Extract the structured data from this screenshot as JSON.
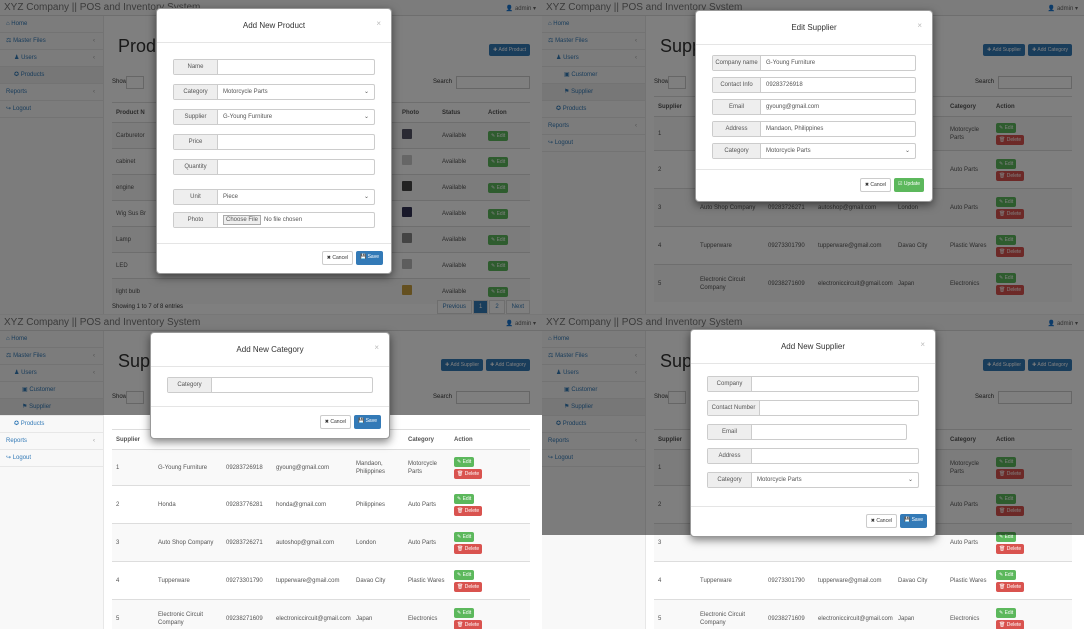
{
  "app_title": "XYZ Company || POS and Inventory System",
  "admin_label": "admin",
  "nav": {
    "home": "Home",
    "master_files": "Master Files",
    "users": "Users",
    "customer": "Customer",
    "supplier": "Supplier",
    "products": "Products",
    "reports": "Reports",
    "logout": "Logout"
  },
  "icons": {
    "home": "home-icon",
    "products": "products-icon",
    "supplier": "supplier-icon",
    "customer": "customer-icon",
    "users": "users-icon",
    "master": "master-files-icon",
    "logout": "logout-icon",
    "user": "user-icon",
    "cancel": "times-icon",
    "save": "floppy-icon",
    "edit": "pencil-icon",
    "delete": "trash-icon"
  },
  "colors": {
    "primary": "#337ab7",
    "success": "#5cb85c",
    "danger": "#d9534f"
  },
  "common": {
    "show": "Show",
    "search": "Search",
    "cancel": "Cancel",
    "save": "Save",
    "update": "Update",
    "edit": "Edit",
    "delete": "Delete",
    "add_supplier": "Add Supplier",
    "add_category": "Add Category",
    "add_product": "Add Product"
  },
  "q1": {
    "title": "Produ",
    "cols": [
      "Product N",
      "",
      "Photo",
      "Status",
      "Action"
    ],
    "rows": [
      {
        "name": "Carburetor",
        "status": "Available"
      },
      {
        "name": "cabinet",
        "status": "Available"
      },
      {
        "name": "engine",
        "status": "Available"
      },
      {
        "name": "Wig Sus Br",
        "status": "Available"
      },
      {
        "name": "Lamp",
        "status": "Available"
      },
      {
        "name": "LED",
        "status": "Available"
      },
      {
        "name": "light bulb",
        "status": "Available"
      }
    ],
    "footer": "Showing 1 to 7 of 8 entries",
    "pager": [
      "Previous",
      "1",
      "2",
      "Next"
    ],
    "modal": {
      "title": "Add New Product",
      "fields": [
        {
          "label": "Name",
          "value": ""
        },
        {
          "label": "Category",
          "value": "Motorcycle Parts"
        },
        {
          "label": "Supplier",
          "value": "G-Young Furniture"
        },
        {
          "label": "Price",
          "value": ""
        },
        {
          "label": "Quantity",
          "value": ""
        },
        {
          "label": "Unit",
          "value": "Piece"
        },
        {
          "label": "Photo",
          "value": "No file chosen"
        }
      ],
      "choose_file": "Choose File"
    }
  },
  "q2": {
    "title": "Supp",
    "cols": [
      "Supplier",
      "",
      "",
      "",
      "Category",
      "Action"
    ],
    "rows": [
      {
        "id": "1",
        "company": "",
        "contact": "",
        "email": "",
        "address": "",
        "category": "Motorcycle Parts"
      },
      {
        "id": "2",
        "company": "",
        "contact": "",
        "email": "",
        "address": "",
        "category": "Auto Parts"
      },
      {
        "id": "3",
        "company": "Auto Shop Company",
        "contact": "09283726271",
        "email": "autoshop@gmail.com",
        "address": "London",
        "category": "Auto Parts"
      },
      {
        "id": "4",
        "company": "Tupperware",
        "contact": "09273301790",
        "email": "tupperware@gmail.com",
        "address": "Davao City",
        "category": "Plastic Wares"
      },
      {
        "id": "5",
        "company": "Electronic Circuit Company",
        "contact": "09238271609",
        "email": "electroniccircuit@gmail.com",
        "address": "Japan",
        "category": "Electronics"
      }
    ],
    "modal": {
      "title": "Edit Supplier",
      "fields": [
        {
          "label": "Company name",
          "value": "G-Young Furniture"
        },
        {
          "label": "Contact Info",
          "value": "09283726918"
        },
        {
          "label": "Email",
          "value": "gyoung@gmail.com"
        },
        {
          "label": "Address",
          "value": "Mandaon, Philippines"
        },
        {
          "label": "Category",
          "value": "Motorcycle Parts"
        }
      ]
    }
  },
  "q3": {
    "title": "Supp",
    "cols": [
      "Supplier",
      "",
      "",
      "",
      "Category",
      "Action"
    ],
    "rows": [
      {
        "id": "1",
        "company": "G-Young Furniture",
        "contact": "09283726918",
        "email": "gyoung@gmail.com",
        "address": "Mandaon, Philippines",
        "category": "Motorcycle Parts"
      },
      {
        "id": "2",
        "company": "Honda",
        "contact": "09283776281",
        "email": "honda@gmail.com",
        "address": "Philippines",
        "category": "Auto Parts"
      },
      {
        "id": "3",
        "company": "Auto Shop Company",
        "contact": "09283726271",
        "email": "autoshop@gmail.com",
        "address": "London",
        "category": "Auto Parts"
      },
      {
        "id": "4",
        "company": "Tupperware",
        "contact": "09273301790",
        "email": "tupperware@gmail.com",
        "address": "Davao City",
        "category": "Plastic Wares"
      },
      {
        "id": "5",
        "company": "Electronic Circuit Company",
        "contact": "09238271609",
        "email": "electroniccircuit@gmail.com",
        "address": "Japan",
        "category": "Electronics"
      }
    ],
    "modal": {
      "title": "Add New Category",
      "fields": [
        {
          "label": "Category",
          "value": ""
        }
      ]
    }
  },
  "q4": {
    "title": "Supp",
    "cols": [
      "Supplier",
      "",
      "",
      "",
      "Category",
      "Action"
    ],
    "rows": [
      {
        "id": "1",
        "company": "",
        "contact": "",
        "email": "",
        "address": "",
        "category": "Motorcycle Parts"
      },
      {
        "id": "2",
        "company": "",
        "contact": "",
        "email": "",
        "address": "",
        "category": "Auto Parts"
      },
      {
        "id": "3",
        "company": "",
        "contact": "",
        "email": "",
        "address": "",
        "category": "Auto Parts"
      },
      {
        "id": "4",
        "company": "Tupperware",
        "contact": "09273301790",
        "email": "tupperware@gmail.com",
        "address": "Davao City",
        "category": "Plastic Wares"
      },
      {
        "id": "5",
        "company": "Electronic Circuit Company",
        "contact": "09238271609",
        "email": "electroniccircuit@gmail.com",
        "address": "Japan",
        "category": "Electronics"
      }
    ],
    "modal": {
      "title": "Add New Supplier",
      "fields": [
        {
          "label": "Company",
          "value": ""
        },
        {
          "label": "Contact Number",
          "value": ""
        },
        {
          "label": "Email",
          "value": ""
        },
        {
          "label": "Address",
          "value": ""
        },
        {
          "label": "Category",
          "value": "Motorcycle Parts"
        }
      ]
    }
  }
}
